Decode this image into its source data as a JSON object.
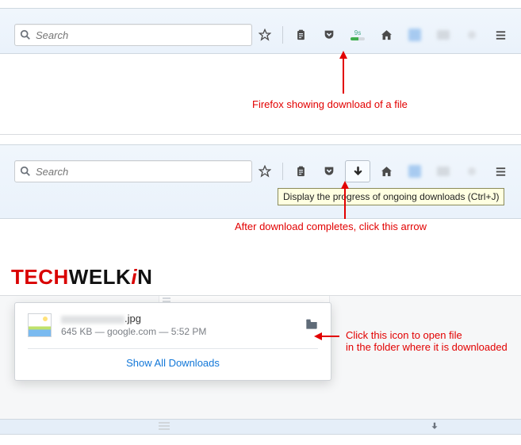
{
  "search": {
    "placeholder": "Search"
  },
  "captions": {
    "downloading": "Firefox showing download of a file",
    "completed": "After download completes, click this arrow",
    "open_folder_1": "Click this icon to open file",
    "open_folder_2": "in the folder where it is downloaded"
  },
  "download_badge": "9s",
  "tooltip": "Display the progress of ongoing downloads (Ctrl+J)",
  "brand": {
    "tech": "TECH",
    "welk": "WELK",
    "i": "i",
    "n": "N"
  },
  "popover": {
    "filename_suffix": ".jpg",
    "meta": "645 KB — google.com — 5:52 PM",
    "show_all": "Show All Downloads"
  }
}
